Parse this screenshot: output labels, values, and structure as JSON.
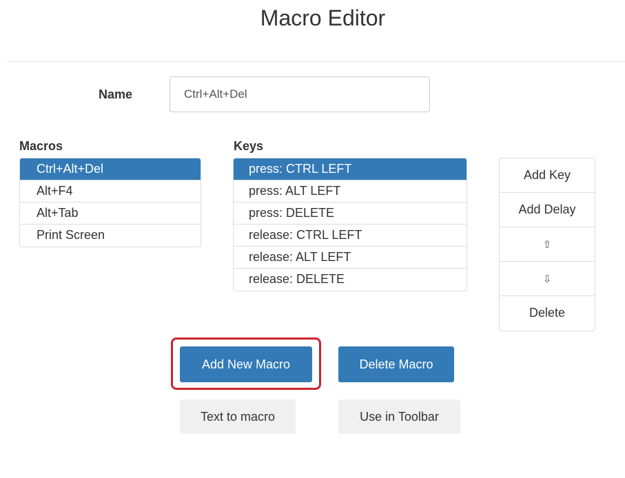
{
  "header": {
    "title": "Macro Editor"
  },
  "name_field": {
    "label": "Name",
    "value": "Ctrl+Alt+Del"
  },
  "macros": {
    "label": "Macros",
    "selected_index": 0,
    "items": [
      {
        "label": "Ctrl+Alt+Del"
      },
      {
        "label": "Alt+F4"
      },
      {
        "label": "Alt+Tab"
      },
      {
        "label": "Print Screen"
      }
    ]
  },
  "keys": {
    "label": "Keys",
    "selected_index": 0,
    "items": [
      {
        "label": "press: CTRL LEFT"
      },
      {
        "label": "press: ALT LEFT"
      },
      {
        "label": "press: DELETE"
      },
      {
        "label": "release: CTRL LEFT"
      },
      {
        "label": "release: ALT LEFT"
      },
      {
        "label": "release: DELETE"
      }
    ]
  },
  "key_actions": {
    "add_key": "Add Key",
    "add_delay": "Add Delay",
    "move_up": "⇧",
    "move_down": "⇩",
    "delete": "Delete"
  },
  "actions": {
    "add_new_macro": "Add New Macro",
    "delete_macro": "Delete Macro",
    "text_to_macro": "Text to macro",
    "use_in_toolbar": "Use in Toolbar"
  },
  "colors": {
    "primary": "#337ab7",
    "highlight_ring": "#c9252c",
    "secondary_bg": "#f0f0f0"
  }
}
